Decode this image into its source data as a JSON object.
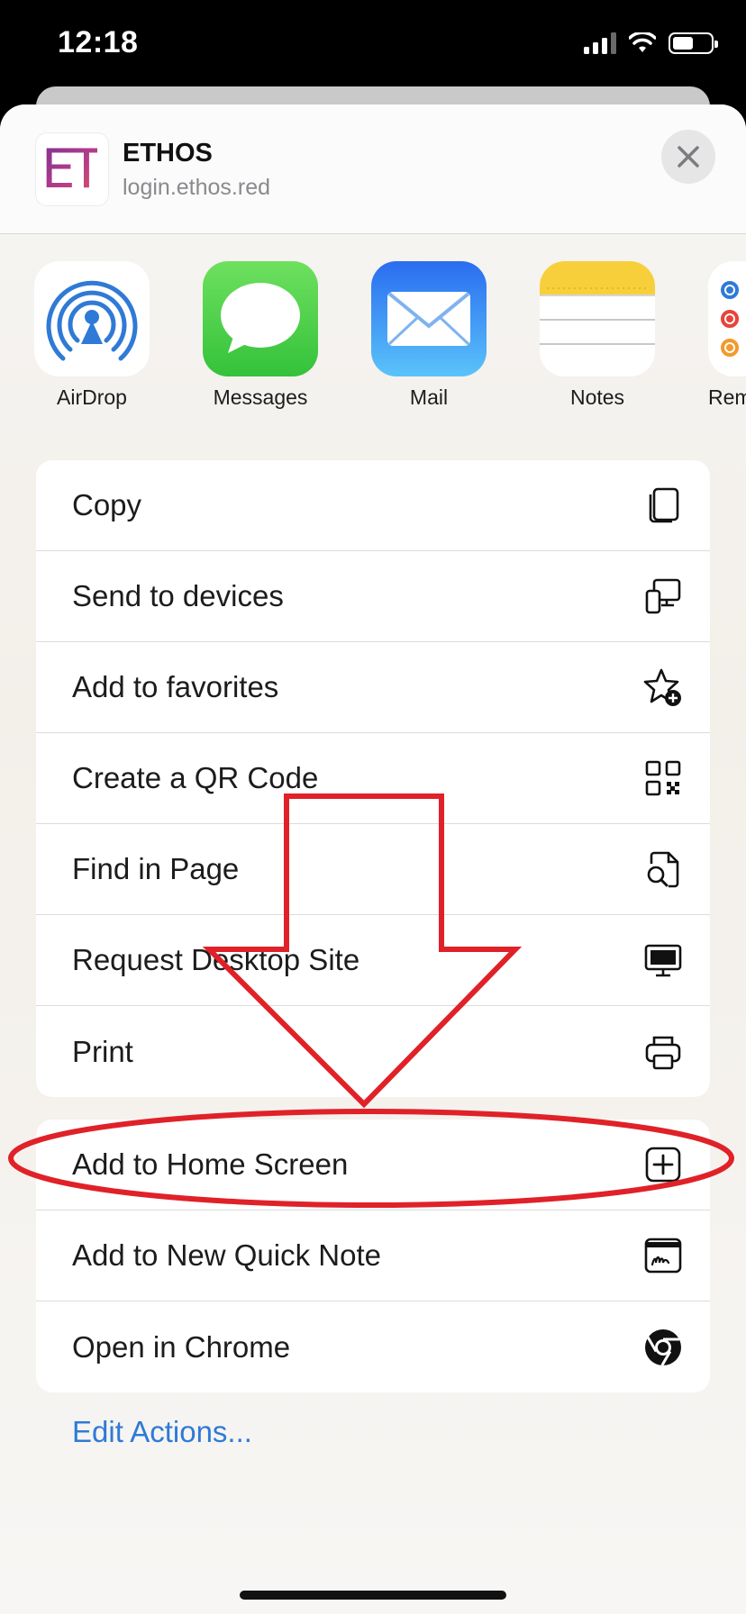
{
  "status_bar": {
    "time": "12:18",
    "battery_level": 0.55
  },
  "share_header": {
    "logo_text": "ET",
    "title": "ETHOS",
    "url": "login.ethos.red",
    "close_icon": "close-icon"
  },
  "apps": [
    {
      "label": "AirDrop",
      "icon": "airdrop-icon"
    },
    {
      "label": "Messages",
      "icon": "messages-icon"
    },
    {
      "label": "Mail",
      "icon": "mail-icon"
    },
    {
      "label": "Notes",
      "icon": "notes-icon"
    },
    {
      "label": "Rem",
      "icon": "reminders-icon"
    }
  ],
  "actions_group_1": [
    {
      "label": "Copy",
      "icon": "copy-icon"
    },
    {
      "label": "Send to devices",
      "icon": "send-to-devices-icon"
    },
    {
      "label": "Add to favorites",
      "icon": "star-plus-icon"
    },
    {
      "label": "Create a QR Code",
      "icon": "qr-code-icon"
    },
    {
      "label": "Find in Page",
      "icon": "find-in-page-icon"
    },
    {
      "label": "Request Desktop Site",
      "icon": "desktop-icon"
    },
    {
      "label": "Print",
      "icon": "printer-icon"
    }
  ],
  "actions_group_2": [
    {
      "label": "Add to Home Screen",
      "icon": "plus-square-icon"
    },
    {
      "label": "Add to New Quick Note",
      "icon": "quick-note-icon"
    },
    {
      "label": "Open in Chrome",
      "icon": "chrome-icon"
    }
  ],
  "edit_actions_label": "Edit Actions...",
  "colors": {
    "accent": "#2f7ad6",
    "annotation_red": "#e02128"
  }
}
